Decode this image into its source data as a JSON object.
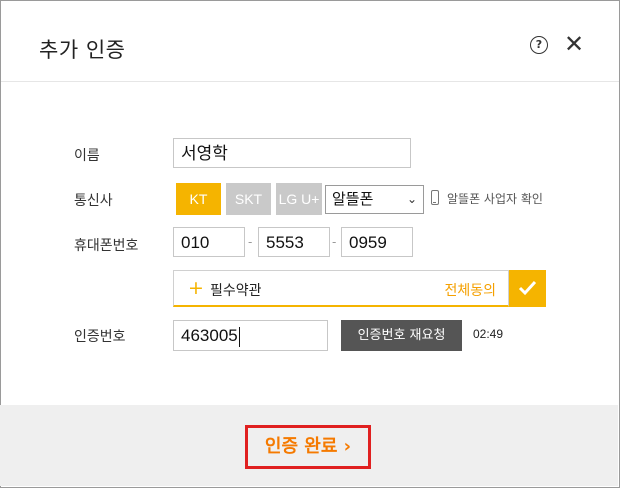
{
  "dialog": {
    "title": "추가 인증",
    "help_glyph": "?",
    "close_glyph": "✕"
  },
  "form": {
    "name_label": "이름",
    "name_value": "서영학",
    "carrier_label": "통신사",
    "carriers": [
      {
        "label": "KT",
        "selected": true
      },
      {
        "label": "SKT",
        "selected": false
      },
      {
        "label": "LG U+",
        "selected": false
      }
    ],
    "mvno_select": {
      "value": "알뜰폰",
      "chevron": "⌄"
    },
    "mvno_check_link": "알뜰폰 사업자 확인",
    "phone_label": "휴대폰번호",
    "phone": [
      "010",
      "5553",
      "0959"
    ],
    "phone_separator": "-",
    "terms": {
      "plus_glyph": "+",
      "label": "필수약관",
      "agree_all": "전체동의"
    },
    "auth_label": "인증번호",
    "auth_value": "463005",
    "resend_label": "인증번호 재요청",
    "timer": "02:49"
  },
  "footer": {
    "complete_label": "인증 완료 ›"
  },
  "colors": {
    "accent": "#f5b400",
    "highlight_border": "#e02020",
    "complete_text": "#f57a00"
  }
}
